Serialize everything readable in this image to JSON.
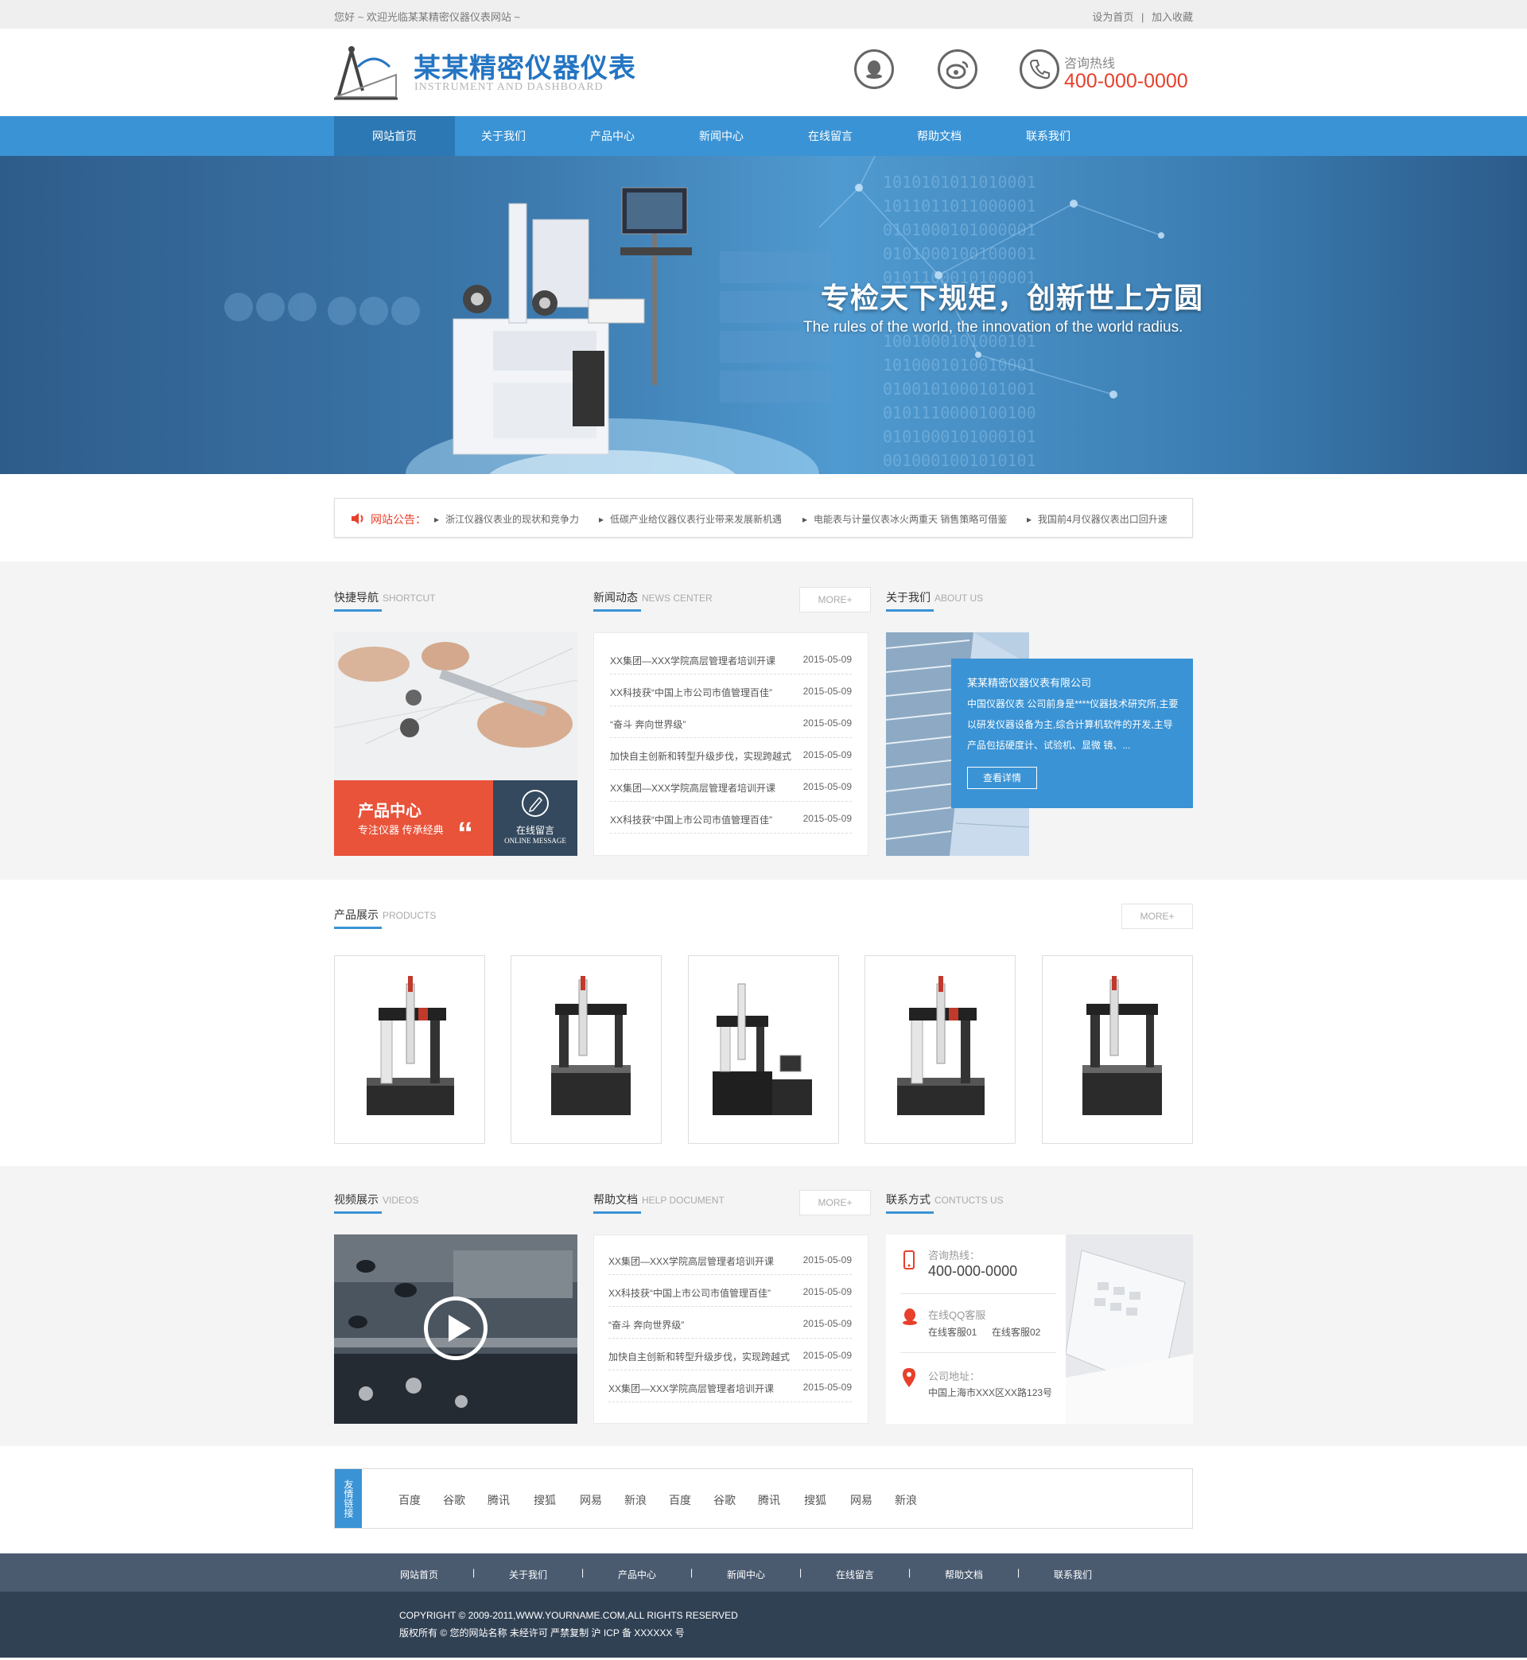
{
  "topbar": {
    "welcome": "您好 ~ 欢迎光临某某精密仪器仪表网站 ~",
    "set_home": "设为首页",
    "sep": "|",
    "bookmark": "加入收藏"
  },
  "header": {
    "brand_cn": "某某精密仪器仪表",
    "brand_en": "INSTRUMENT AND DASHBOARD",
    "hotline_label": "咨询热线",
    "hotline": "400-000-0000"
  },
  "nav": [
    "网站首页",
    "关于我们",
    "产品中心",
    "新闻中心",
    "在线留言",
    "帮助文档",
    "联系我们"
  ],
  "banner": {
    "slogan": "专检天下规矩，创新世上方圆",
    "slogan_en": "The rules of the world, the innovation of the world radius."
  },
  "notice": {
    "label": "网站公告：",
    "items": [
      "浙江仪器仪表业的现状和竞争力",
      "低碳产业给仪器仪表行业带来发展新机遇",
      "电能表与计量仪表冰火两重天 销售策略可借鉴",
      "我国前4月仪器仪表出口回升速"
    ]
  },
  "shortcut": {
    "title": "快捷导航",
    "title_en": "SHORTCUT",
    "product_title": "产品中心",
    "product_sub": "专注仪器 传承经典",
    "quote": "“",
    "msg_title": "在线留言",
    "msg_en": "ONLINE MESSAGE"
  },
  "news": {
    "title": "新闻动态",
    "title_en": "NEWS CENTER",
    "more": "MORE+",
    "items": [
      {
        "t": "XX集团—XXX学院高层管理者培训开课",
        "d": "2015-05-09"
      },
      {
        "t": "XX科技获“中国上市公司市值管理百佳”",
        "d": "2015-05-09"
      },
      {
        "t": "“奋斗 奔向世界级”",
        "d": "2015-05-09"
      },
      {
        "t": "加快自主创新和转型升级步伐，实现跨越式",
        "d": "2015-05-09"
      },
      {
        "t": "XX集团—XXX学院高层管理者培训开课",
        "d": "2015-05-09"
      },
      {
        "t": "XX科技获“中国上市公司市值管理百佳”",
        "d": "2015-05-09"
      }
    ]
  },
  "about": {
    "title": "关于我们",
    "title_en": "ABOUT US",
    "company": "某某精密仪器仪表有限公司",
    "desc": "中国仪器仪表 公司前身是****仪器技术研究所,主要以研发仪器设备为主,综合计算机软件的开发,主导产品包括硬度计、试验机、显微 镜、...",
    "btn": "查看详情"
  },
  "products": {
    "title": "产品展示",
    "title_en": "PRODUCTS",
    "more": "MORE+"
  },
  "videos": {
    "title": "视频展示",
    "title_en": "VIDEOS"
  },
  "help": {
    "title": "帮助文档",
    "title_en": "HELP DOCUMENT",
    "more": "MORE+",
    "items": [
      {
        "t": "XX集团—XXX学院高层管理者培训开课",
        "d": "2015-05-09"
      },
      {
        "t": "XX科技获“中国上市公司市值管理百佳”",
        "d": "2015-05-09"
      },
      {
        "t": "“奋斗 奔向世界级”",
        "d": "2015-05-09"
      },
      {
        "t": "加快自主创新和转型升级步伐，实现跨越式",
        "d": "2015-05-09"
      },
      {
        "t": "XX集团—XXX学院高层管理者培训开课",
        "d": "2015-05-09"
      }
    ]
  },
  "contact": {
    "title": "联系方式",
    "title_en": "CONTUCTS US",
    "hotline_label": "咨询热线：",
    "hotline": "400-000-0000",
    "qq_label": "在线QQ客服",
    "qq1": "在线客服01",
    "qq2": "在线客服02",
    "addr_label": "公司地址：",
    "addr": "中国上海市XXX区XX路123号"
  },
  "links": {
    "tag": "友情链接",
    "items": [
      "百度",
      "谷歌",
      "腾讯",
      "搜狐",
      "网易",
      "新浪",
      "百度",
      "谷歌",
      "腾讯",
      "搜狐",
      "网易",
      "新浪"
    ]
  },
  "footer": {
    "nav": [
      "网站首页",
      "关于我们",
      "产品中心",
      "新闻中心",
      "在线留言",
      "帮助文档",
      "联系我们"
    ],
    "sep": "|",
    "copyright": "COPYRIGHT © 2009-2011,WWW.YOURNAME.COM,ALL RIGHTS RESERVED",
    "icp": "版权所有 © 您的网站名称 未经许可 严禁复制 沪 ICP 备 XXXXXX 号"
  },
  "colors": {
    "accent": "#3a93d5",
    "nav_active": "#2b78b4",
    "red": "#e8402b",
    "product_tile": "#e8533a",
    "message_tile": "#34495e",
    "footer_nav": "#4a5b70",
    "footer": "#314154"
  }
}
